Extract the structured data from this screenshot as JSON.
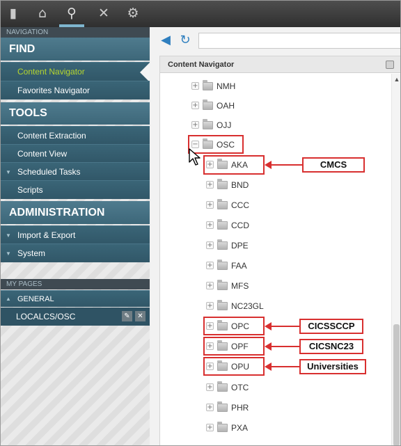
{
  "toolbar": {
    "icons": [
      "sidebar-toggle-icon",
      "home-icon",
      "search-icon",
      "tools-icon",
      "settings-icon"
    ]
  },
  "sidebar": {
    "header": "NAVIGATION",
    "find": {
      "title": "FIND",
      "items": [
        "Content Navigator",
        "Favorites Navigator"
      ]
    },
    "tools": {
      "title": "TOOLS",
      "items": [
        "Content Extraction",
        "Content View",
        "Scheduled Tasks",
        "Scripts"
      ]
    },
    "administration": {
      "title": "ADMINISTRATION",
      "items": [
        "Import & Export",
        "System"
      ]
    },
    "my_pages": {
      "header": "MY PAGES",
      "group": "GENERAL",
      "item": "LOCALCS/OSC"
    }
  },
  "main": {
    "panel_title": "Content Navigator",
    "tree": {
      "top_nodes": [
        "NMH",
        "OAH",
        "OJJ",
        "OSC"
      ],
      "children": [
        "AKA",
        "BND",
        "CCC",
        "CCD",
        "DPE",
        "FAA",
        "MFS",
        "NC23GL",
        "OPC",
        "OPF",
        "OPU",
        "OTC",
        "PHR",
        "PXA"
      ]
    },
    "callouts": {
      "aka": "CMCS",
      "opc": "CICSSCCP",
      "opf": "CICSNC23",
      "opu": "Universities"
    }
  },
  "colors": {
    "sidebar_blue": "#3a6577",
    "active_item": "#b6d62e",
    "callout_red": "#d82f2f",
    "back_arrow": "#2f7fbf"
  }
}
